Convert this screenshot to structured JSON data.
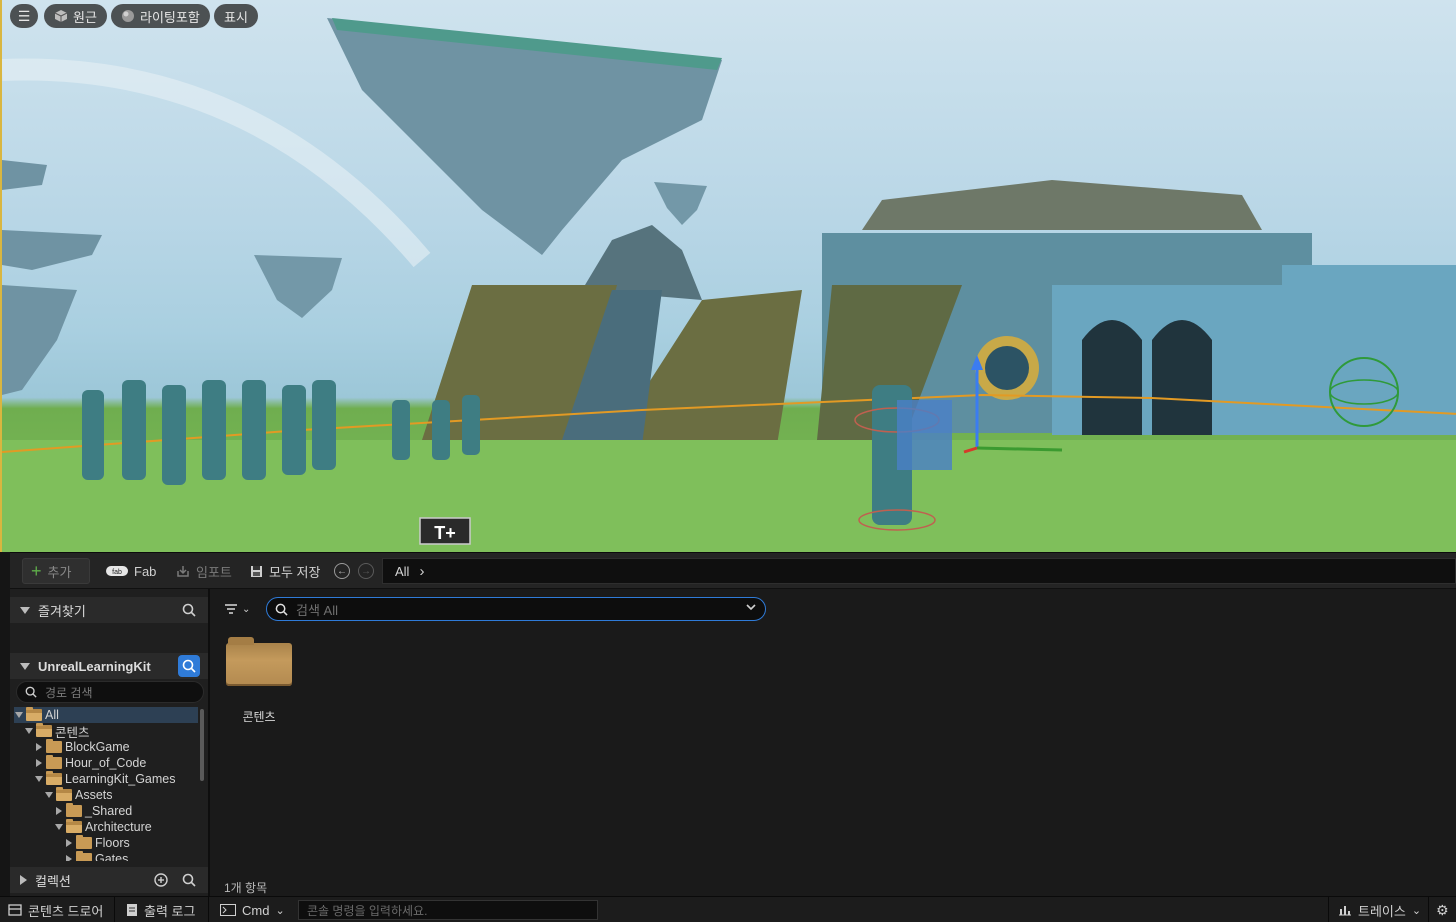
{
  "viewport": {
    "menu_icon": "hamburger-icon",
    "buttons": [
      {
        "label": "원근",
        "icon": "cube-icon"
      },
      {
        "label": "라이팅포함",
        "icon": "sphere-icon"
      },
      {
        "label": "표시",
        "icon": ""
      }
    ]
  },
  "toolbar": {
    "add_label": "추가",
    "fab_label": "Fab",
    "import_label": "임포트",
    "save_all_label": "모두 저장",
    "path": "All"
  },
  "sidebar": {
    "favorites_label": "즐겨찾기",
    "project_label": "UnrealLearningKit",
    "path_search_placeholder": "경로 검색",
    "collections_label": "컬렉션",
    "tree": [
      {
        "label": "All",
        "depth": 0,
        "expanded": true,
        "selected": true
      },
      {
        "label": "콘텐츠",
        "depth": 1,
        "expanded": true
      },
      {
        "label": "BlockGame",
        "depth": 2,
        "expanded": false
      },
      {
        "label": "Hour_of_Code",
        "depth": 2,
        "expanded": false
      },
      {
        "label": "LearningKit_Games",
        "depth": 2,
        "expanded": true
      },
      {
        "label": "Assets",
        "depth": 3,
        "expanded": true
      },
      {
        "label": "_Shared",
        "depth": 4,
        "expanded": false
      },
      {
        "label": "Architecture",
        "depth": 4,
        "expanded": true
      },
      {
        "label": "Floors",
        "depth": 5,
        "expanded": false
      },
      {
        "label": "Gates",
        "depth": 5,
        "expanded": false
      }
    ]
  },
  "main": {
    "search_placeholder": "검색 All",
    "assets": [
      {
        "label": "콘텐츠",
        "type": "folder"
      }
    ],
    "item_count": "1개 항목"
  },
  "statusbar": {
    "content_drawer": "콘텐츠 드로어",
    "output_log": "출력 로그",
    "cmd": "Cmd",
    "console_placeholder": "콘솔 명령을 입력하세요.",
    "trace": "트레이스"
  },
  "colors": {
    "accent": "#2f7bd8",
    "selection": "#2d4054",
    "folder": "#c89a55"
  }
}
